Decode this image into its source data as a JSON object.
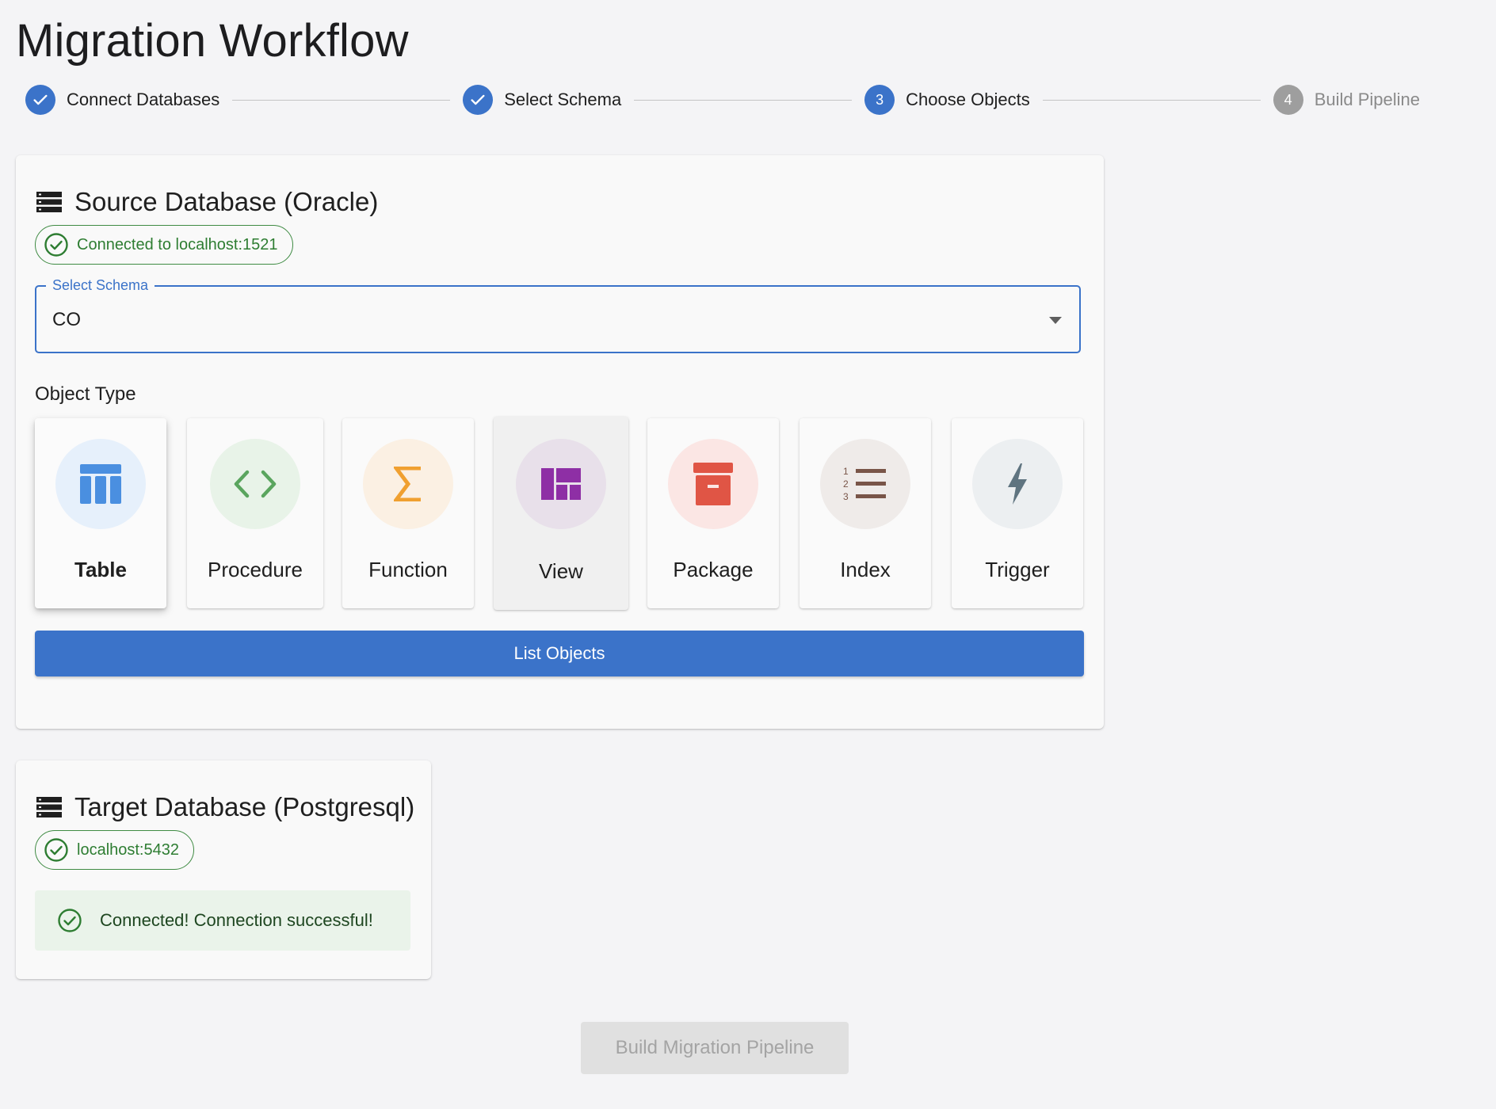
{
  "page": {
    "title": "Migration Workflow"
  },
  "stepper": {
    "steps": [
      {
        "label": "Connect Databases",
        "state": "done",
        "number": "1"
      },
      {
        "label": "Select Schema",
        "state": "done",
        "number": "2"
      },
      {
        "label": "Choose Objects",
        "state": "active",
        "number": "3"
      },
      {
        "label": "Build Pipeline",
        "state": "pending",
        "number": "4"
      }
    ]
  },
  "source": {
    "title": "Source Database (Oracle)",
    "connection_label": "Connected to localhost:1521",
    "schema_select": {
      "label": "Select Schema",
      "value": "CO"
    },
    "object_type_label": "Object Type",
    "object_types": [
      {
        "label": "Table",
        "icon": "table-icon",
        "color": "#4a8fe0",
        "bg": "#e6f0fb",
        "selected": true
      },
      {
        "label": "Procedure",
        "icon": "code-icon",
        "color": "#5aa55e",
        "bg": "#e8f3e8",
        "selected": false
      },
      {
        "label": "Function",
        "icon": "sigma-icon",
        "color": "#f0a030",
        "bg": "#fbf0e3",
        "selected": false
      },
      {
        "label": "View",
        "icon": "dashboard-icon",
        "color": "#8e2fa5",
        "bg": "#e8e0ea",
        "selected": false
      },
      {
        "label": "Package",
        "icon": "archive-icon",
        "color": "#e05545",
        "bg": "#fbe6e4",
        "selected": false
      },
      {
        "label": "Index",
        "icon": "numbered-list-icon",
        "color": "#795548",
        "bg": "#efebe9",
        "selected": false
      },
      {
        "label": "Trigger",
        "icon": "bolt-icon",
        "color": "#5f7480",
        "bg": "#eceff1",
        "selected": false
      }
    ],
    "list_button": "List Objects"
  },
  "target": {
    "title": "Target Database (Postgresql)",
    "connection_label": "localhost:5432",
    "alert": "Connected! Connection successful!"
  },
  "build_button": "Build Migration Pipeline",
  "colors": {
    "primary": "#3b73c9",
    "success": "#2e7d32",
    "success_bg": "#eaf3ea",
    "disabled_bg": "#e0e0e0",
    "pending": "#9e9e9e"
  }
}
